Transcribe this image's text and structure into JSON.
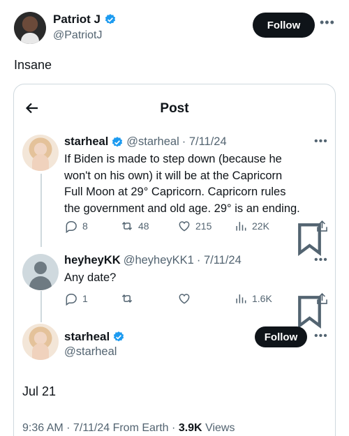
{
  "outer": {
    "name": "Patriot J",
    "handle": "@PatriotJ",
    "follow_label": "Follow",
    "more_label": "•••",
    "text": "Insane"
  },
  "card": {
    "title": "Post",
    "tweets": [
      {
        "name": "starheal",
        "handle": "@starheal",
        "date": "· 7/11/24",
        "more": "•••",
        "lines": [
          "If Biden is made to step down (because he",
          "won't on his own) it will be at the Capricorn",
          "Full Moon at 29° Capricorn. Capricorn rules",
          "the government and old age. 29° is an ending."
        ],
        "replies": "8",
        "reposts": "48",
        "likes": "215",
        "views": "22K"
      },
      {
        "name": "heyheyKK",
        "handle": "@heyheyKK1",
        "date": "· 7/11/24",
        "more": "•••",
        "lines": [
          "Any date?"
        ],
        "replies": "1",
        "views": "1.6K"
      }
    ],
    "main": {
      "name": "starheal",
      "handle": "@starheal",
      "follow_label": "Follow",
      "more": "•••",
      "text": "Jul 21",
      "time": "9:36 AM · 7/11/24 From Earth ·",
      "views_count": "3.9K",
      "views_label": "Views"
    }
  },
  "colors": {
    "verified": "#1d9bf0",
    "secondary": "#536471",
    "border": "#cfd9de"
  }
}
